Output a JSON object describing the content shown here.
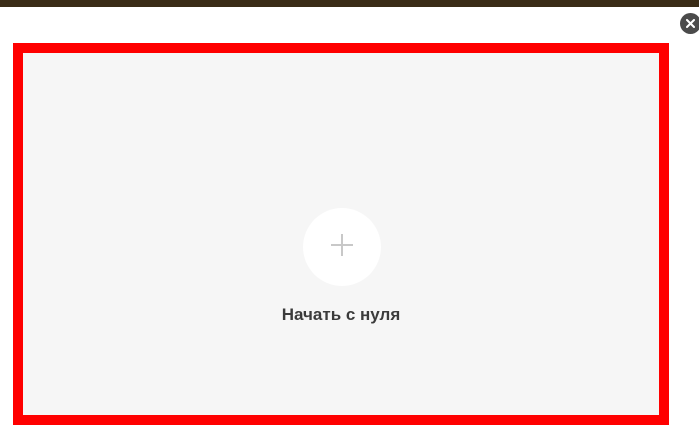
{
  "dialog": {
    "close_icon": "close-icon",
    "card": {
      "plus_icon": "plus-icon",
      "label": "Начать с нуля"
    }
  },
  "colors": {
    "top_strip": "#3a2c16",
    "card_background": "#f6f6f6",
    "highlight_border": "#ff0000",
    "close_button": "#4b4b4b",
    "plus_icon": "#c8c8c8",
    "label_text": "#3b3b3b"
  }
}
